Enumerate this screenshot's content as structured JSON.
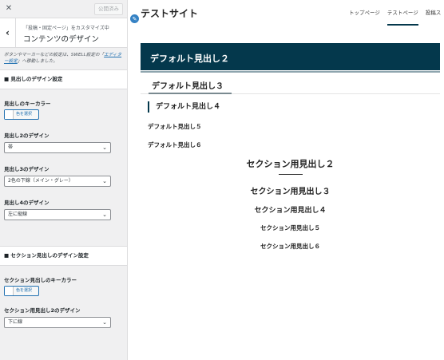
{
  "sidebar": {
    "close_icon": "close-icon",
    "publish_label": "公開済み",
    "back_icon": "chevron-left-icon",
    "breadcrumb": "「投稿・固定ページ」をカスタマイズ中",
    "title": "コンテンツのデザイン",
    "notice_prefix": "ボタンやマーカーなどの設定は、SWELL設定の「",
    "notice_link": "エディター設定",
    "notice_suffix": "」へ移動しました。",
    "heading_design": {
      "title": "■ 見出しのデザイン設定",
      "key_color_label": "見出しのキーカラー",
      "color_button": "色を選択",
      "h2_label": "見出し2のデザイン",
      "h2_value": "帯",
      "h3_label": "見出し3のデザイン",
      "h3_value": "2色の下線（メイン・グレー）",
      "h4_label": "見出し4のデザイン",
      "h4_value": "左に縦線"
    },
    "section_design": {
      "title": "■ セクション見出しのデザイン設定",
      "key_color_label": "セクション見出しのキーカラー",
      "color_button": "色を選択",
      "h2_label": "セクション用見出し2のデザイン",
      "h2_value": "下に線"
    }
  },
  "preview": {
    "site_title": "テストサイト",
    "nav": [
      "トップページ",
      "テストページ",
      "投稿ス"
    ],
    "active_nav_index": 1,
    "headings": {
      "h2": "デフォルト見出し２",
      "h3": "デフォルト見出し３",
      "h4": "デフォルト見出し４",
      "h5": "デフォルト見出し５",
      "h6": "デフォルト見出し６"
    },
    "section_headings": {
      "h2": "セクション用見出し２",
      "h3": "セクション用見出し３",
      "h4": "セクション用見出し４",
      "h5": "セクション用見出し５",
      "h6": "セクション用見出し６"
    }
  },
  "colors": {
    "main": "#04384c",
    "accent_link": "#2271b1",
    "sidebar_bg": "#f0f0f1"
  }
}
